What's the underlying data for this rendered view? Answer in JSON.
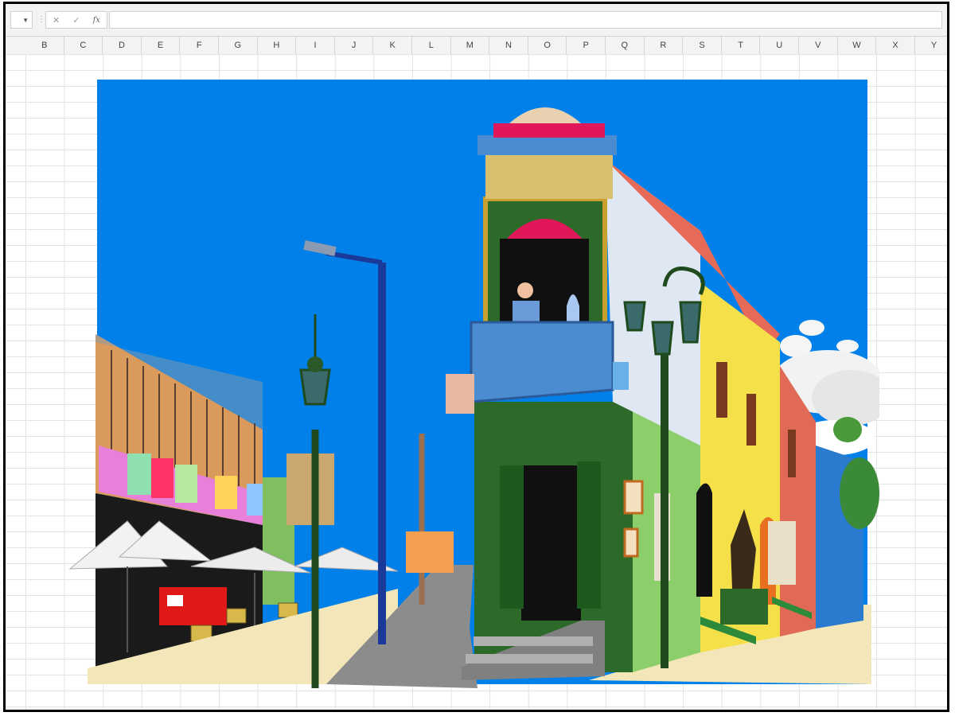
{
  "toolbar": {
    "icons": [
      "caret-down-icon",
      "cancel-icon",
      "confirm-icon",
      "function-icon"
    ],
    "fx_label": "fx",
    "formula_value": ""
  },
  "columns": [
    "B",
    "C",
    "D",
    "E",
    "F",
    "G",
    "H",
    "I",
    "J",
    "K",
    "L",
    "M",
    "N",
    "O",
    "P",
    "Q",
    "R",
    "S",
    "T",
    "U",
    "V",
    "W",
    "X",
    "Y"
  ],
  "artwork": {
    "subject": "Illustration of a colorful street corner",
    "colors": {
      "sky": "#0080e8",
      "facade_green": "#2d6a2a",
      "facade_yellow": "#f5e04a",
      "facade_red": "#e06a55",
      "balcony_blue": "#4a8ccf",
      "lamp_green": "#1e4a1e"
    }
  }
}
